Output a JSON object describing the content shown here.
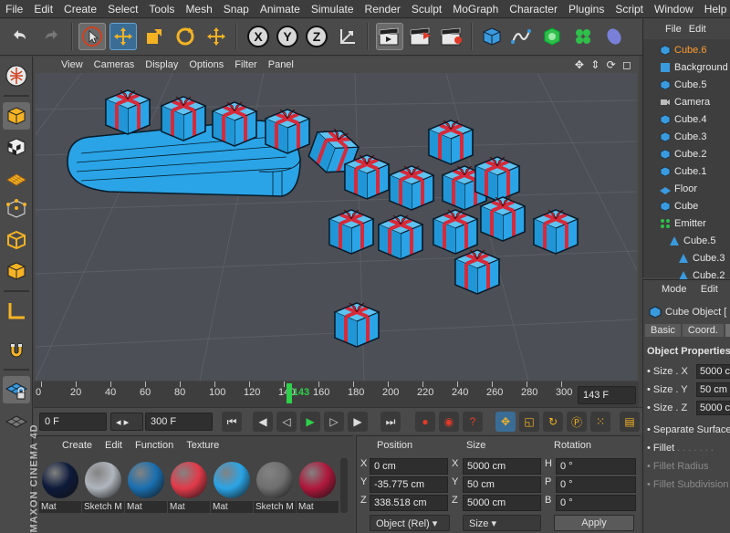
{
  "menubar": {
    "items": [
      "File",
      "Edit",
      "Create",
      "Select",
      "Tools",
      "Mesh",
      "Snap",
      "Animate",
      "Simulate",
      "Render",
      "Sculpt",
      "MoGraph",
      "Character",
      "Plugins",
      "Script",
      "Window",
      "Help"
    ]
  },
  "toolbar": {
    "axis_x": "X",
    "axis_y": "Y",
    "axis_z": "Z"
  },
  "viewport": {
    "menu": [
      "View",
      "Cameras",
      "Display",
      "Options",
      "Filter",
      "Panel"
    ],
    "nav_icons": "✥ ⇕ ⟳ ◻"
  },
  "timeline": {
    "ticks": [
      "0",
      "20",
      "40",
      "60",
      "80",
      "100",
      "120",
      "140",
      "143",
      "160",
      "180",
      "200",
      "220",
      "240",
      "260",
      "280",
      "300"
    ],
    "current_frame_label": "143",
    "current_frame_fraction": 0.4767,
    "frame_field": "143 F"
  },
  "transport": {
    "start": "0 F",
    "end": "300 F"
  },
  "materials": {
    "menu": [
      "Create",
      "Edit",
      "Function",
      "Texture"
    ],
    "items": [
      {
        "label": "Mat",
        "color": "#0d1a3a"
      },
      {
        "label": "Sketch M",
        "color": "#b0b6bd"
      },
      {
        "label": "Mat",
        "color": "#1a6fb0"
      },
      {
        "label": "Mat",
        "color": "#e23a4a"
      },
      {
        "label": "Mat",
        "color": "#2aa4e6"
      },
      {
        "label": "Sketch M",
        "color": "#6f6f6f"
      },
      {
        "label": "Mat",
        "color": "#b0183c"
      }
    ]
  },
  "coordinates": {
    "headers": {
      "position": "Position",
      "size": "Size",
      "rotation": "Rotation"
    },
    "rows": [
      {
        "axis": "X",
        "pos": "0 cm",
        "size_axis": "X",
        "size": "5000 cm",
        "rot_axis": "H",
        "rot": "0 °"
      },
      {
        "axis": "Y",
        "pos": "-35.775 cm",
        "size_axis": "Y",
        "size": "50 cm",
        "rot_axis": "P",
        "rot": "0 °"
      },
      {
        "axis": "Z",
        "pos": "338.518 cm",
        "size_axis": "Z",
        "size": "5000 cm",
        "rot_axis": "B",
        "rot": "0 °"
      }
    ],
    "mode": "Object (Rel)",
    "size_mode": "Size",
    "apply": "Apply"
  },
  "objects": {
    "menu": [
      "File",
      "Edit"
    ],
    "items": [
      {
        "name": "Cube.6",
        "highlight": true,
        "indent": 0
      },
      {
        "name": "Background",
        "highlight": false,
        "indent": 0
      },
      {
        "name": "Cube.5",
        "highlight": false,
        "indent": 0
      },
      {
        "name": "Camera",
        "highlight": false,
        "indent": 0
      },
      {
        "name": "Cube.4",
        "highlight": false,
        "indent": 0
      },
      {
        "name": "Cube.3",
        "highlight": false,
        "indent": 0
      },
      {
        "name": "Cube.2",
        "highlight": false,
        "indent": 0
      },
      {
        "name": "Cube.1",
        "highlight": false,
        "indent": 0
      },
      {
        "name": "Floor",
        "highlight": false,
        "indent": 0
      },
      {
        "name": "Cube",
        "highlight": false,
        "indent": 0
      },
      {
        "name": "Emitter",
        "highlight": false,
        "indent": 0
      },
      {
        "name": "Cube.5",
        "highlight": false,
        "indent": 1
      },
      {
        "name": "Cube.3",
        "highlight": false,
        "indent": 2
      },
      {
        "name": "Cube.2",
        "highlight": false,
        "indent": 2
      }
    ]
  },
  "attributes": {
    "menu": [
      "Mode",
      "Edit"
    ],
    "object_title": "Cube Object [",
    "tabs": [
      "Basic",
      "Coord.",
      "O"
    ],
    "section": "Object Properties",
    "size_x_label": "Size . X",
    "size_x": "5000 c",
    "size_y_label": "Size . Y",
    "size_y": "50 cm",
    "size_z_label": "Size . Z",
    "size_z": "5000 c",
    "separate": "Separate Surfaces",
    "fillet": "Fillet",
    "fillet_radius": "Fillet Radius",
    "fillet_subdiv": "Fillet Subdivision"
  },
  "branding": {
    "logo": "MAXON CINEMA 4D"
  },
  "colors": {
    "accent_blue": "#3a8fd0",
    "highlight_orange": "#ff9d2e",
    "gift_blue": "#2aa4e6",
    "ribbon_red": "#d62a3a"
  }
}
